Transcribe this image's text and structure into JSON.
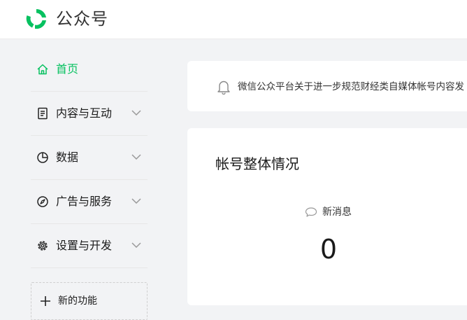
{
  "header": {
    "app_title": "公众号",
    "logo_icon": "wechat-official-account-logo-icon",
    "brand_color": "#07c160"
  },
  "sidebar": {
    "items": [
      {
        "label": "首页",
        "icon": "home-icon",
        "active": true,
        "expandable": false
      },
      {
        "label": "内容与互动",
        "icon": "document-icon",
        "active": false,
        "expandable": true
      },
      {
        "label": "数据",
        "icon": "pie-chart-icon",
        "active": false,
        "expandable": true
      },
      {
        "label": "广告与服务",
        "icon": "compass-icon",
        "active": false,
        "expandable": true
      },
      {
        "label": "设置与开发",
        "icon": "gear-icon",
        "active": false,
        "expandable": true
      }
    ],
    "new_feature": {
      "label": "新的功能",
      "icon": "plus-icon"
    }
  },
  "notice": {
    "icon": "bell-icon",
    "text": "微信公众平台关于进一步规范财经类自媒体帐号内容发"
  },
  "account_overview": {
    "title": "帐号整体情况",
    "stats": [
      {
        "label": "新消息",
        "icon": "chat-bubble-icon",
        "value": "0"
      }
    ]
  }
}
